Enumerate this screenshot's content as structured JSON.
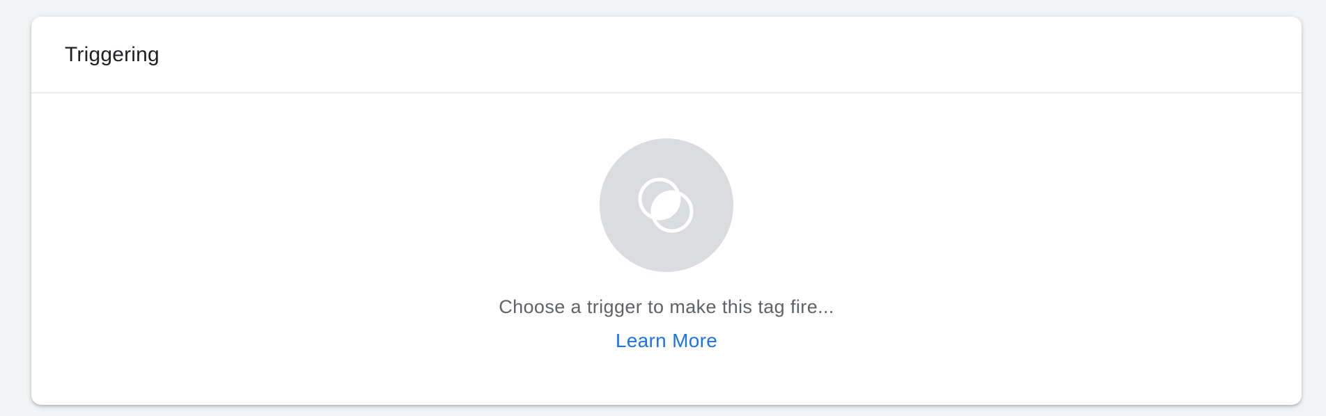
{
  "panel": {
    "title": "Triggering",
    "icon": "trigger-icon",
    "empty_message": "Choose a trigger to make this tag fire...",
    "learn_more_label": "Learn More"
  },
  "colors": {
    "page_background": "#f1f3f4",
    "card_background": "#ffffff",
    "icon_circle": "#dadce0",
    "link": "#1a73e8",
    "message_text": "#5f6368"
  }
}
